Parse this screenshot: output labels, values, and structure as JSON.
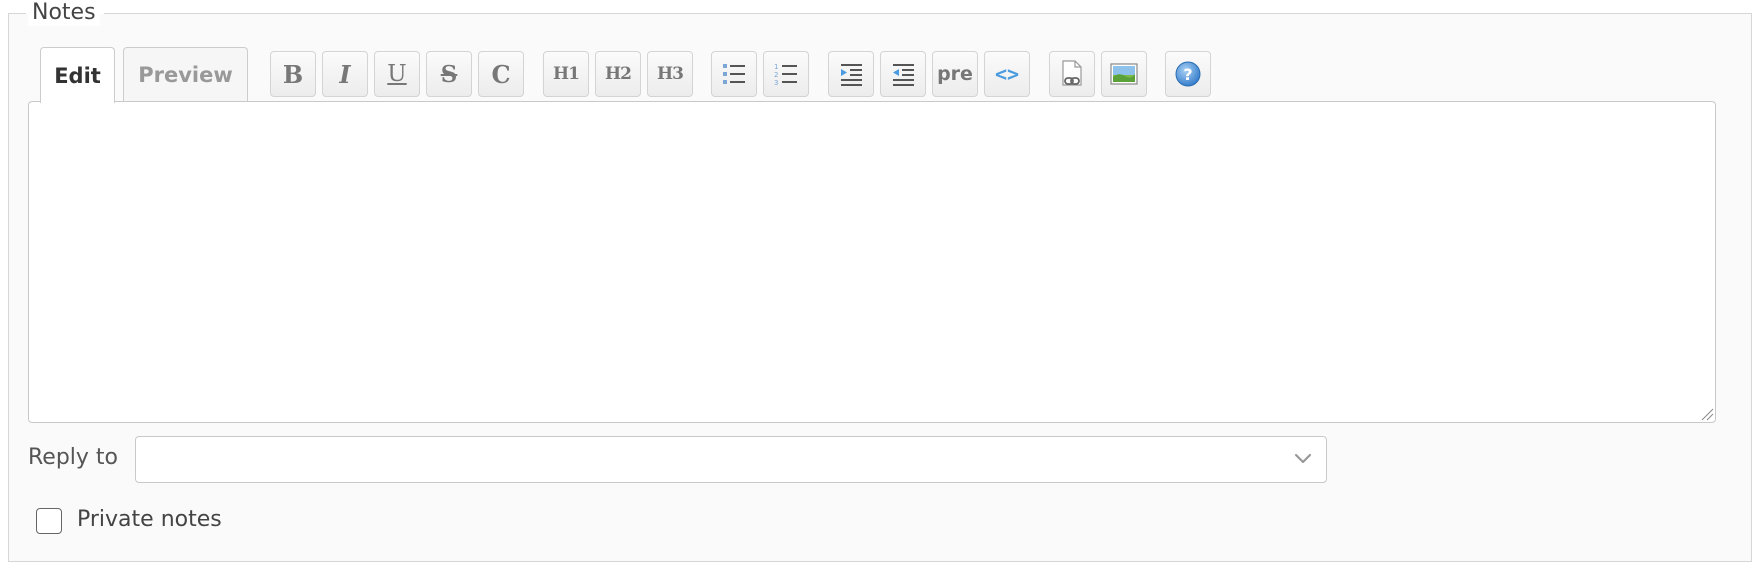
{
  "notes": {
    "legend": "Notes",
    "tabs": [
      {
        "label": "Edit",
        "active": true
      },
      {
        "label": "Preview",
        "active": false
      }
    ],
    "toolbar": {
      "bold": "B",
      "italic": "I",
      "underline": "U",
      "strike": "S",
      "code_inline": "C",
      "h1": "H1",
      "h2": "H2",
      "h3": "H3",
      "pre": "pre",
      "code_block": "<>",
      "icons": [
        "bold-icon",
        "italic-icon",
        "underline-icon",
        "strikethrough-icon",
        "inline-code-icon",
        "heading1-icon",
        "heading2-icon",
        "heading3-icon",
        "bulleted-list-icon",
        "numbered-list-icon",
        "indent-icon",
        "outdent-icon",
        "preformatted-icon",
        "code-block-icon",
        "attachment-link-icon",
        "image-icon",
        "help-icon"
      ]
    },
    "editor": {
      "value": "",
      "placeholder": ""
    },
    "reply_to": {
      "label": "Reply to",
      "value": ""
    },
    "private_notes": {
      "label": "Private notes",
      "checked": false
    },
    "colors": {
      "accent": "#4a9be0",
      "border": "#c9c9c9",
      "background": "#fafafa"
    }
  }
}
